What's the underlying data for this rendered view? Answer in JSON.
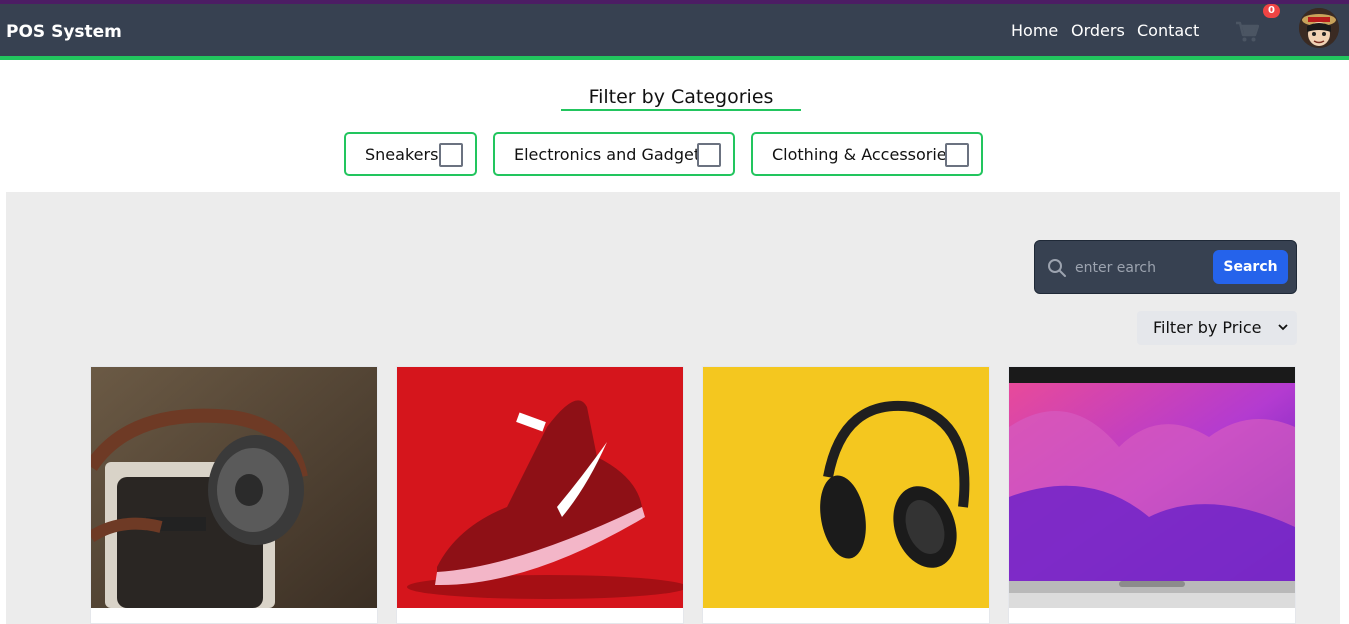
{
  "navbar": {
    "brand": "POS System",
    "links": [
      "Home",
      "Orders",
      "Contact"
    ],
    "cart_count": "0"
  },
  "filters": {
    "title": "Filter by Categories",
    "categories": [
      "Sneakers",
      "Electronics and Gadgets",
      "Clothing & Accessories"
    ]
  },
  "search": {
    "placeholder": "enter earch",
    "button_label": "Search"
  },
  "price_filter": {
    "selected": "Filter by Price"
  },
  "colors": {
    "navbar": "#374151",
    "accent": "#22c55e",
    "search_button": "#2563eb",
    "badge": "#ef4444"
  },
  "products": [
    {
      "image": "headphones-on-speaker"
    },
    {
      "image": "red-nike-sneaker"
    },
    {
      "image": "black-headphones-yellow-background"
    },
    {
      "image": "macbook-pro"
    }
  ]
}
